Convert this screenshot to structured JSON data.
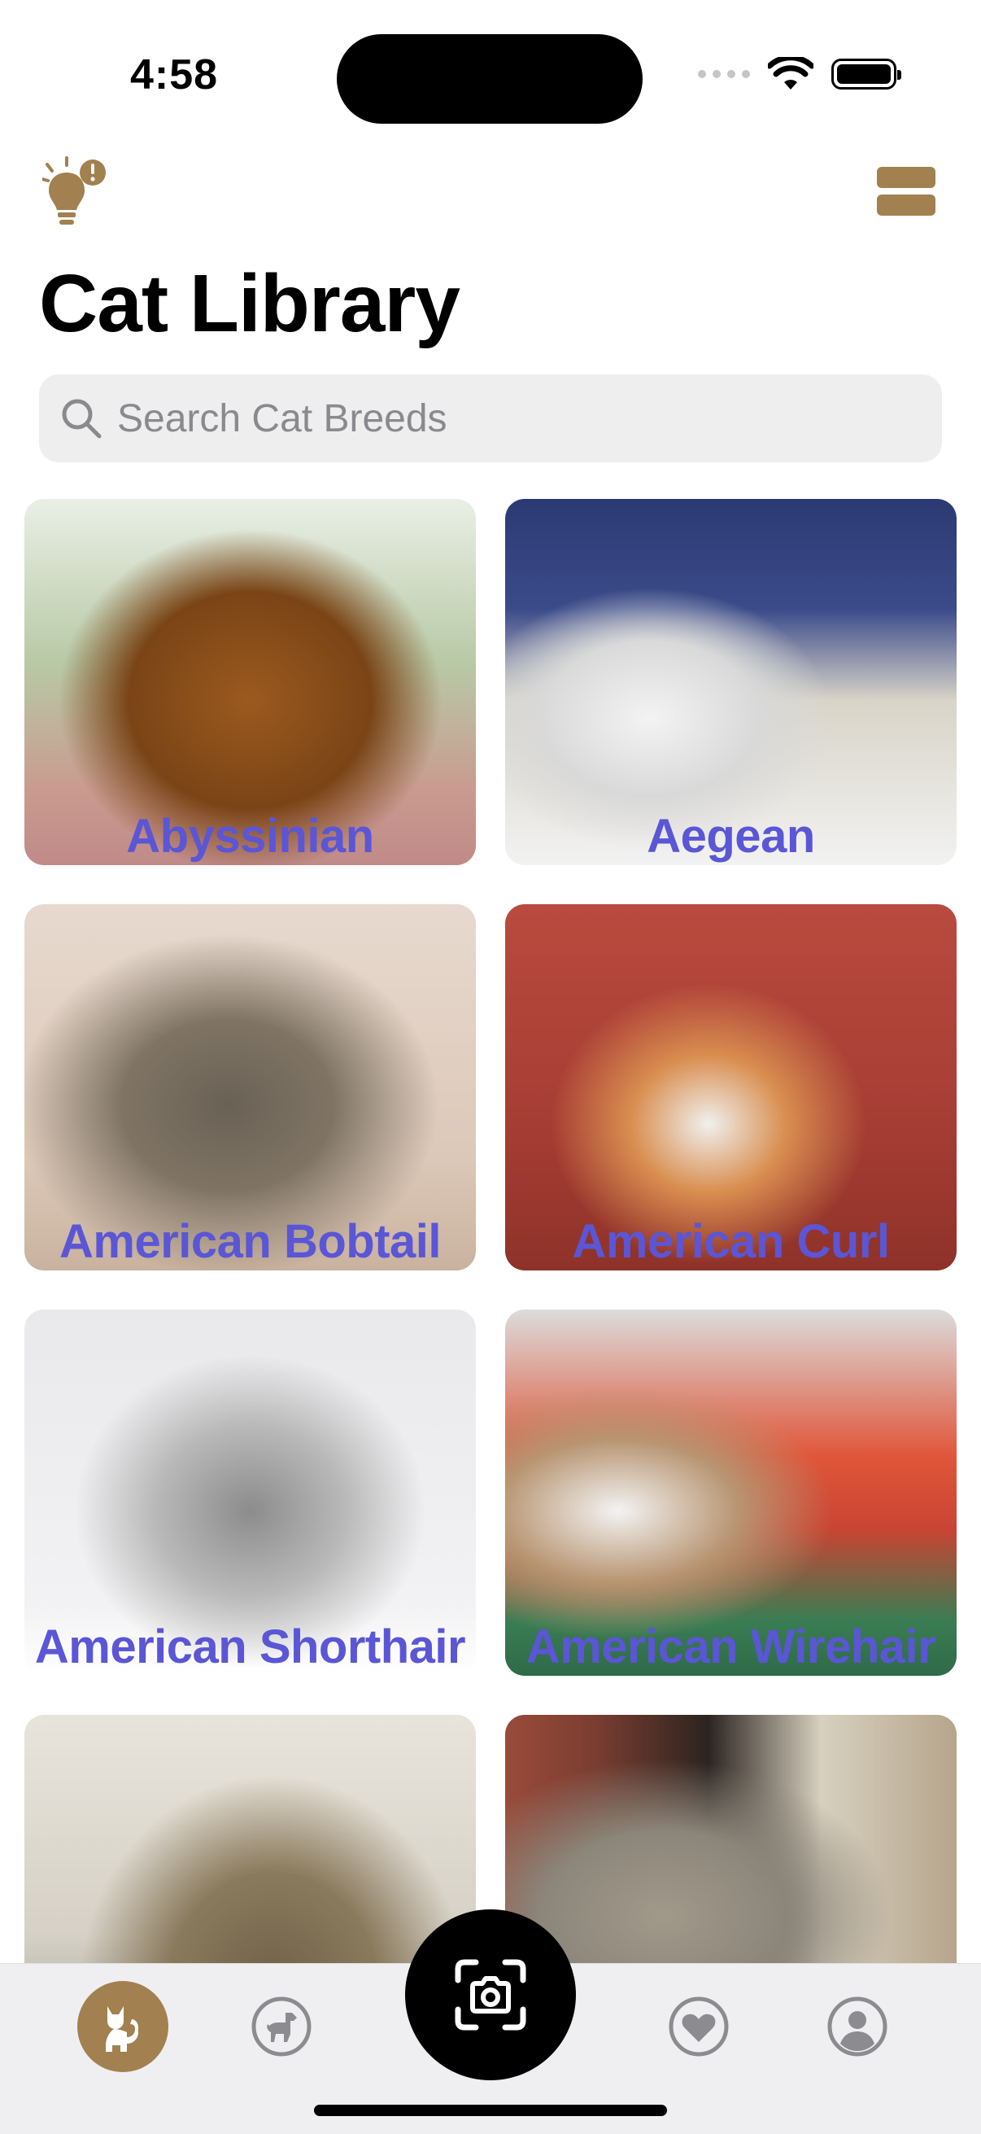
{
  "status_bar": {
    "time": "4:58"
  },
  "header": {
    "title": "Cat Library"
  },
  "search": {
    "placeholder": "Search Cat Breeds",
    "value": ""
  },
  "breeds": [
    {
      "name": "Abyssinian"
    },
    {
      "name": "Aegean"
    },
    {
      "name": "American Bobtail"
    },
    {
      "name": "American Curl"
    },
    {
      "name": "American Shorthair"
    },
    {
      "name": "American Wirehair"
    },
    {
      "name": ""
    },
    {
      "name": ""
    }
  ],
  "tab_bar": {
    "items": [
      {
        "icon": "cat-icon",
        "active": true
      },
      {
        "icon": "dog-icon",
        "active": false
      },
      {
        "icon": "camera-scan-icon",
        "active": false
      },
      {
        "icon": "heart-icon",
        "active": false
      },
      {
        "icon": "profile-icon",
        "active": false
      }
    ]
  },
  "colors": {
    "accent": "#a2804f",
    "breed_label": "#5a56d6",
    "search_bg": "#eeeeef",
    "tab_bar_bg": "#efeff1"
  }
}
